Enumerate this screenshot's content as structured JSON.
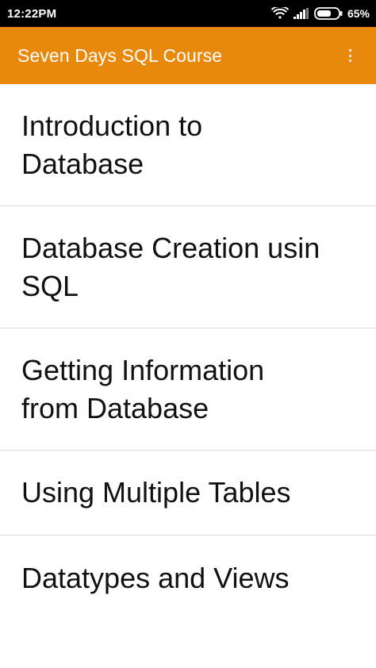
{
  "status_bar": {
    "time": "12:22PM",
    "battery": "65%",
    "icons": [
      "wifi-icon",
      "signal-icon",
      "battery-icon"
    ]
  },
  "app_bar": {
    "title": "Seven Days SQL Course",
    "menu_icon": "overflow-menu-icon",
    "background_color": "#E8890C"
  },
  "lessons": [
    {
      "label": "Introduction to\nDatabase"
    },
    {
      "label": "Database Creation usin\nSQL"
    },
    {
      "label": "Getting Information\nfrom Database"
    },
    {
      "label": "Using Multiple Tables"
    },
    {
      "label": "Datatypes and Views"
    }
  ]
}
